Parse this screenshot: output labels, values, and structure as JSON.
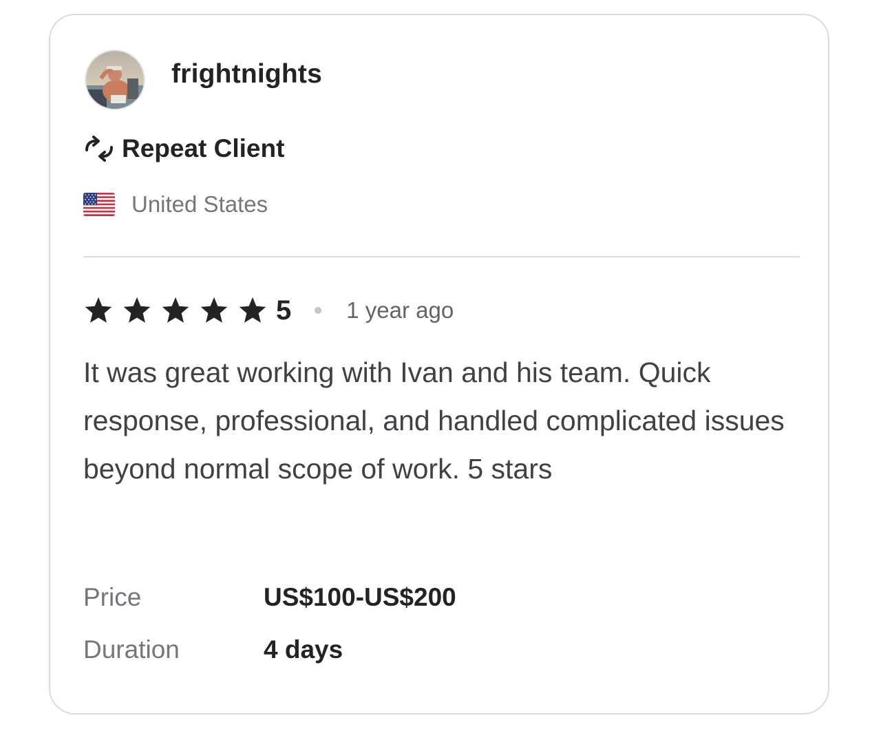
{
  "reviewer": {
    "username": "frightnights",
    "badge": "Repeat Client",
    "country": "United States"
  },
  "review": {
    "rating_value": "5",
    "rating_stars": 5,
    "time_ago": "1 year ago",
    "text": "It was great working with Ivan and his team. Quick response, professional, and handled complicated issues beyond normal scope of work. 5 stars"
  },
  "details": {
    "price_label": "Price",
    "price_value": "US$100-US$200",
    "duration_label": "Duration",
    "duration_value": "4 days"
  },
  "icons": {
    "avatar": "avatar-photo",
    "badge": "repeat-icon",
    "flag": "us-flag-icon",
    "star": "star-icon"
  },
  "colors": {
    "text_primary": "#222325",
    "text_secondary": "#74767e",
    "border": "#dadbdd"
  }
}
